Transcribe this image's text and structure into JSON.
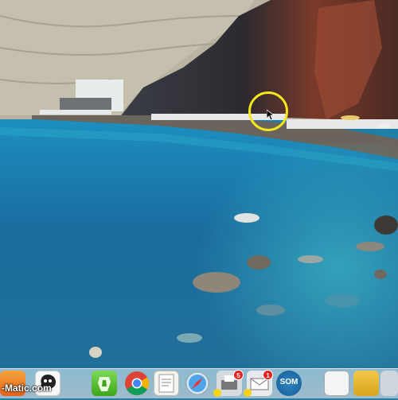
{
  "watermark": {
    "prefix": "-",
    "brand": "Matic",
    "suffix": ".com"
  },
  "dock": {
    "items": [
      {
        "name": "screencast-o-matic"
      },
      {
        "name": "gimp"
      },
      {
        "name": "evernote"
      },
      {
        "name": "chrome"
      },
      {
        "name": "textedit"
      },
      {
        "name": "safari"
      },
      {
        "name": "printer"
      },
      {
        "name": "mail"
      },
      {
        "name": "som"
      },
      {
        "name": "documents"
      },
      {
        "name": "notes"
      },
      {
        "name": "finder-folder"
      }
    ],
    "badge_printer": "5",
    "badge_mail": "1",
    "som_label": "SOM"
  },
  "colors": {
    "ring": "#f3e61b",
    "badge": "#e8231f"
  }
}
